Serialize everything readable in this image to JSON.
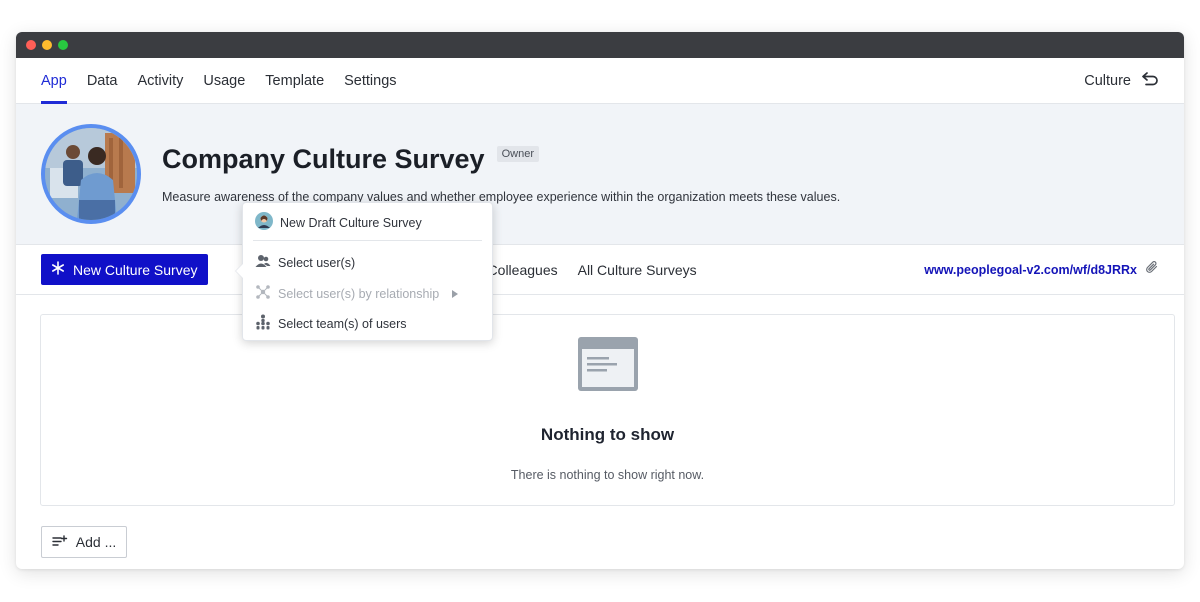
{
  "nav": {
    "tabs": [
      {
        "label": "App"
      },
      {
        "label": "Data"
      },
      {
        "label": "Activity"
      },
      {
        "label": "Usage"
      },
      {
        "label": "Template"
      },
      {
        "label": "Settings"
      }
    ],
    "right_label": "Culture",
    "right_icon": "back-arrow-icon",
    "accent": "#1f2bd6"
  },
  "hero": {
    "title": "Company Culture Survey",
    "badge": "Owner",
    "description": "Measure awareness of the company values and whether employee experience within the organization meets these values."
  },
  "actionbar": {
    "primary_label": "New Culture Survey",
    "primary_color": "#1010c8",
    "subtabs": [
      {
        "label": "r Colleagues"
      },
      {
        "label": "All Culture Surveys"
      }
    ],
    "link": "www.peoplegoal-v2.com/wf/d8JRRx",
    "link_icon": "paperclip-icon"
  },
  "dropdown": {
    "items": [
      {
        "label": "New Draft Culture Survey",
        "icon": "avatar-icon"
      },
      {
        "label": "Select user(s)",
        "icon": "users-icon"
      },
      {
        "label": "Select user(s) by relationship",
        "icon": "relationship-icon",
        "disabled": true
      },
      {
        "label": "Select team(s) of users",
        "icon": "team-icon"
      }
    ]
  },
  "empty": {
    "title": "Nothing to show",
    "subtitle": "There is nothing to show right now."
  },
  "add_button": {
    "label": "Add ..."
  }
}
